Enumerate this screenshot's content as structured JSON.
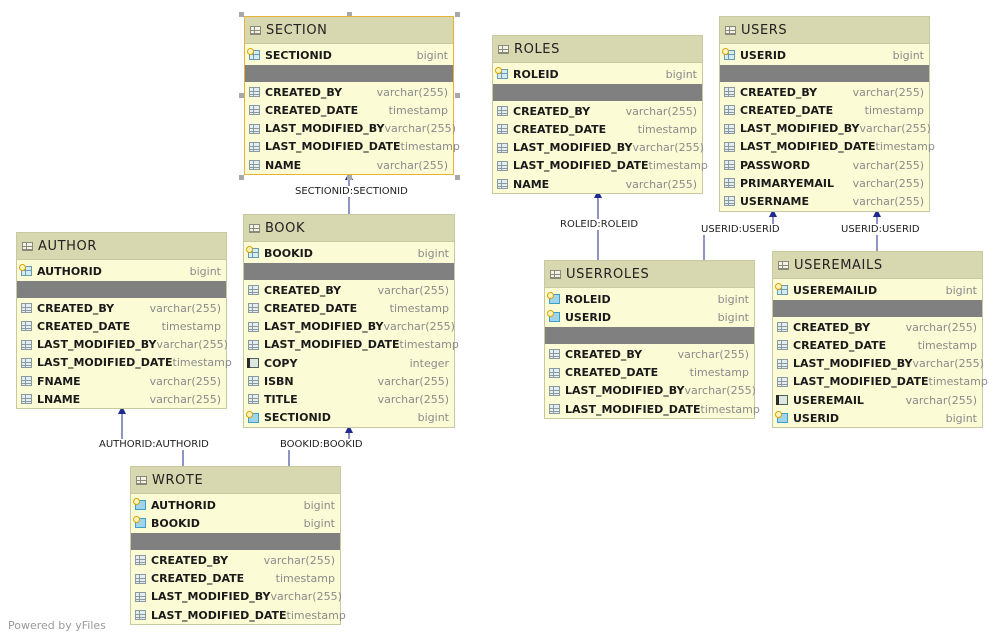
{
  "tables": {
    "section": {
      "name": "SECTION",
      "fields": [
        {
          "name": "SECTIONID",
          "type": "bigint",
          "icon": "primary-key-icon"
        }
      ],
      "fields2": [
        {
          "name": "CREATED_BY",
          "type": "varchar(255)"
        },
        {
          "name": "CREATED_DATE",
          "type": "timestamp"
        },
        {
          "name": "LAST_MODIFIED_BY",
          "type": "varchar(255)"
        },
        {
          "name": "LAST_MODIFIED_DATE",
          "type": "timestamp"
        },
        {
          "name": "NAME",
          "type": "varchar(255)"
        }
      ]
    },
    "roles": {
      "name": "ROLES",
      "fields": [
        {
          "name": "ROLEID",
          "type": "bigint",
          "icon": "primary-key-icon"
        }
      ],
      "fields2": [
        {
          "name": "CREATED_BY",
          "type": "varchar(255)"
        },
        {
          "name": "CREATED_DATE",
          "type": "timestamp"
        },
        {
          "name": "LAST_MODIFIED_BY",
          "type": "varchar(255)"
        },
        {
          "name": "LAST_MODIFIED_DATE",
          "type": "timestamp"
        },
        {
          "name": "NAME",
          "type": "varchar(255)"
        }
      ]
    },
    "users": {
      "name": "USERS",
      "fields": [
        {
          "name": "USERID",
          "type": "bigint",
          "icon": "primary-key-icon"
        }
      ],
      "fields2": [
        {
          "name": "CREATED_BY",
          "type": "varchar(255)"
        },
        {
          "name": "CREATED_DATE",
          "type": "timestamp"
        },
        {
          "name": "LAST_MODIFIED_BY",
          "type": "varchar(255)"
        },
        {
          "name": "LAST_MODIFIED_DATE",
          "type": "timestamp"
        },
        {
          "name": "PASSWORD",
          "type": "varchar(255)"
        },
        {
          "name": "PRIMARYEMAIL",
          "type": "varchar(255)"
        },
        {
          "name": "USERNAME",
          "type": "varchar(255)"
        }
      ]
    },
    "author": {
      "name": "AUTHOR",
      "fields": [
        {
          "name": "AUTHORID",
          "type": "bigint",
          "icon": "primary-key-icon"
        }
      ],
      "fields2": [
        {
          "name": "CREATED_BY",
          "type": "varchar(255)"
        },
        {
          "name": "CREATED_DATE",
          "type": "timestamp"
        },
        {
          "name": "LAST_MODIFIED_BY",
          "type": "varchar(255)"
        },
        {
          "name": "LAST_MODIFIED_DATE",
          "type": "timestamp"
        },
        {
          "name": "FNAME",
          "type": "varchar(255)"
        },
        {
          "name": "LNAME",
          "type": "varchar(255)"
        }
      ]
    },
    "book": {
      "name": "BOOK",
      "fields": [
        {
          "name": "BOOKID",
          "type": "bigint",
          "icon": "primary-key-icon"
        }
      ],
      "fields2": [
        {
          "name": "CREATED_BY",
          "type": "varchar(255)"
        },
        {
          "name": "CREATED_DATE",
          "type": "timestamp"
        },
        {
          "name": "LAST_MODIFIED_BY",
          "type": "varchar(255)"
        },
        {
          "name": "LAST_MODIFIED_DATE",
          "type": "timestamp"
        },
        {
          "name": "COPY",
          "type": "integer",
          "icon": "index-icon"
        },
        {
          "name": "ISBN",
          "type": "varchar(255)"
        },
        {
          "name": "TITLE",
          "type": "varchar(255)"
        },
        {
          "name": "SECTIONID",
          "type": "bigint",
          "icon": "foreign-key-icon"
        }
      ]
    },
    "userroles": {
      "name": "USERROLES",
      "fields": [
        {
          "name": "ROLEID",
          "type": "bigint",
          "icon": "foreign-key-icon"
        },
        {
          "name": "USERID",
          "type": "bigint",
          "icon": "foreign-key-icon"
        }
      ],
      "fields2": [
        {
          "name": "CREATED_BY",
          "type": "varchar(255)"
        },
        {
          "name": "CREATED_DATE",
          "type": "timestamp"
        },
        {
          "name": "LAST_MODIFIED_BY",
          "type": "varchar(255)"
        },
        {
          "name": "LAST_MODIFIED_DATE",
          "type": "timestamp"
        }
      ]
    },
    "useremails": {
      "name": "USEREMAILS",
      "fields": [
        {
          "name": "USEREMAILID",
          "type": "bigint",
          "icon": "primary-key-icon"
        }
      ],
      "fields2": [
        {
          "name": "CREATED_BY",
          "type": "varchar(255)"
        },
        {
          "name": "CREATED_DATE",
          "type": "timestamp"
        },
        {
          "name": "LAST_MODIFIED_BY",
          "type": "varchar(255)"
        },
        {
          "name": "LAST_MODIFIED_DATE",
          "type": "timestamp"
        },
        {
          "name": "USEREMAIL",
          "type": "varchar(255)",
          "icon": "index-icon"
        },
        {
          "name": "USERID",
          "type": "bigint",
          "icon": "foreign-key-icon"
        }
      ]
    },
    "wrote": {
      "name": "WROTE",
      "fields": [
        {
          "name": "AUTHORID",
          "type": "bigint",
          "icon": "foreign-key-icon"
        },
        {
          "name": "BOOKID",
          "type": "bigint",
          "icon": "foreign-key-icon"
        }
      ],
      "fields2": [
        {
          "name": "CREATED_BY",
          "type": "varchar(255)"
        },
        {
          "name": "CREATED_DATE",
          "type": "timestamp"
        },
        {
          "name": "LAST_MODIFIED_BY",
          "type": "varchar(255)"
        },
        {
          "name": "LAST_MODIFIED_DATE",
          "type": "timestamp"
        }
      ]
    }
  },
  "edges": [
    {
      "id": "book-section",
      "label": "SECTIONID:SECTIONID"
    },
    {
      "id": "userroles-roles",
      "label": "ROLEID:ROLEID"
    },
    {
      "id": "userroles-users",
      "label": "USERID:USERID"
    },
    {
      "id": "useremails-users",
      "label": "USERID:USERID"
    },
    {
      "id": "wrote-author",
      "label": "AUTHORID:AUTHORID"
    },
    {
      "id": "wrote-book",
      "label": "BOOKID:BOOKID"
    }
  ],
  "colors": {
    "table_body": "#fbfbd6",
    "table_header": "#d7d7b0",
    "separator": "#808080",
    "edge": "#1f2a8a",
    "selected_border": "#e8b23a"
  },
  "footer": "Powered by yFiles"
}
